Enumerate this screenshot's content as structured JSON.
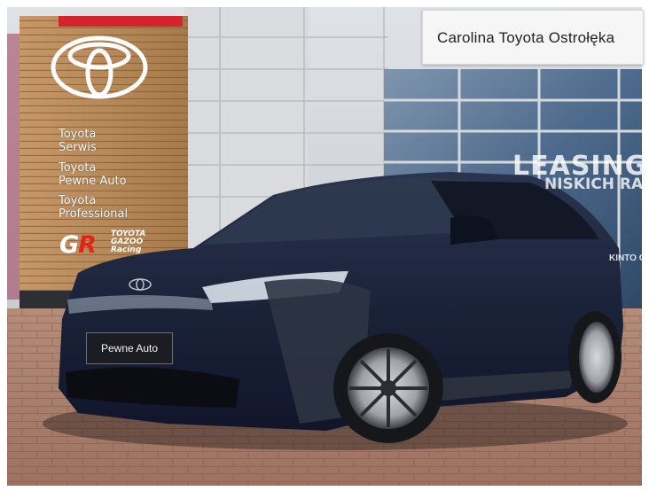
{
  "dealer_sign": {
    "text": "Carolina Toyota Ostrołęka"
  },
  "pylon": {
    "lines": [
      "Toyota",
      "Serwis",
      "Toyota",
      "Pewne Auto",
      "Toyota",
      "Professional"
    ],
    "gr_logo": "GR",
    "gr_sub": [
      "TOYOTA",
      "GAZOO",
      "Racing"
    ]
  },
  "window_ad": {
    "line1": "LEASING",
    "line2": "NISKICH RA",
    "corner": "KINTO ONE"
  },
  "plate": {
    "text": "Pewne Auto"
  },
  "colors": {
    "car_body": "#1a2238",
    "pylon_wood": "#b88a58",
    "pavement": "#a97e6a",
    "toyota_red": "#e1251b"
  }
}
